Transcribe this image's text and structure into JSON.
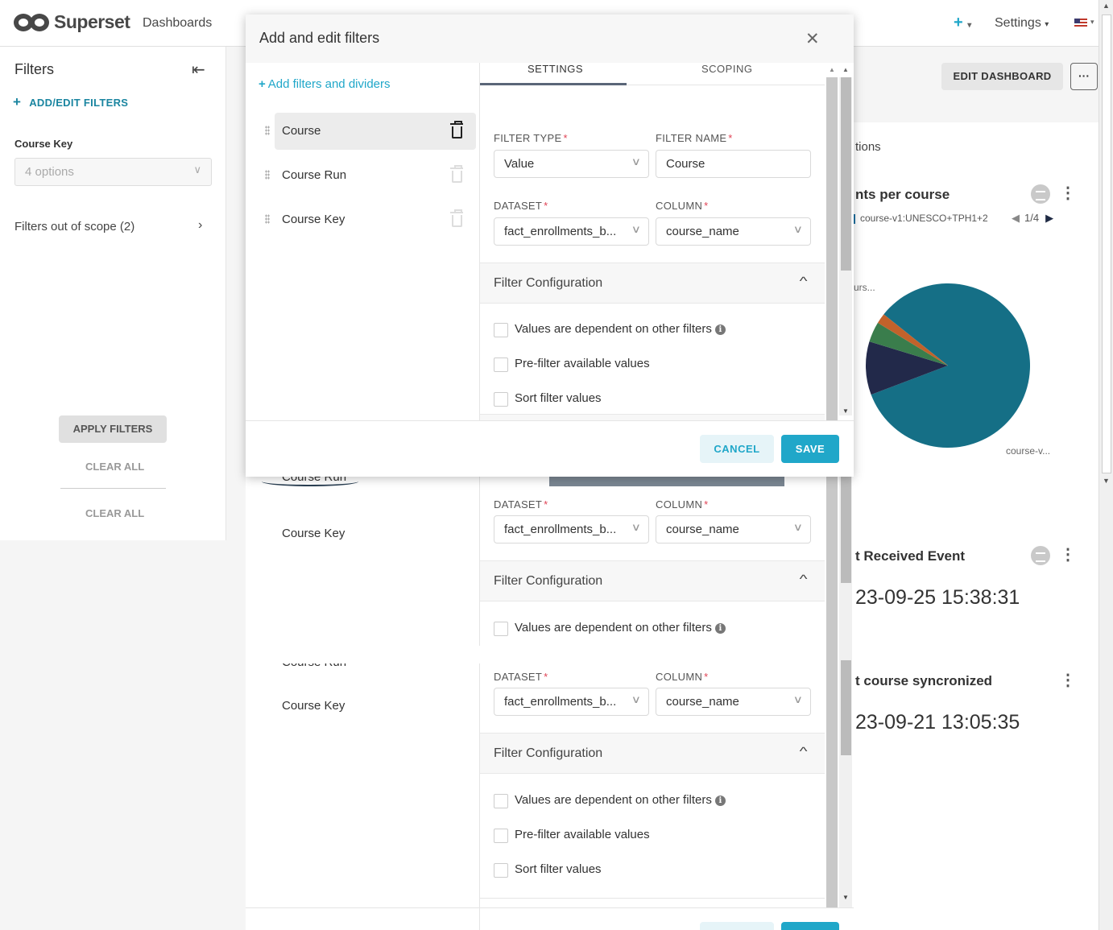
{
  "nav": {
    "brand": "Superset",
    "dashboards": "Dashboards",
    "plus": "+",
    "settings": "Settings"
  },
  "sidebar": {
    "title": "Filters",
    "add_edit": "ADD/EDIT FILTERS",
    "course_key_label": "Course Key",
    "course_key_placeholder": "4 options",
    "out_of_scope": "Filters out of scope (2)",
    "apply": "APPLY FILTERS",
    "clear_all_1": "CLEAR ALL",
    "clear_all_2": "CLEAR ALL"
  },
  "dashboard": {
    "edit_button": "EDIT DASHBOARD",
    "more": "···",
    "partial_header": "tions",
    "chart_title": "nts per course",
    "legend_item": "course-v1:UNESCO+TPH1+2",
    "pager": "1/4",
    "pie_label_top": "urs...",
    "pie_label_bottom": "course-v...",
    "event_title": "t Received Event",
    "event_value": "23-09-25 15:38:31",
    "sync_title": "t course syncronized",
    "sync_value": "23-09-21 13:05:35",
    "pie_colors": [
      "#156f86",
      "#22294a",
      "#3a7d4c",
      "#c2622b"
    ],
    "pie_values": [
      0.835,
      0.105,
      0.04,
      0.02
    ]
  },
  "modal": {
    "title": "Add and edit filters",
    "add_link": "Add filters and dividers",
    "filters": [
      {
        "name": "Course",
        "active": true
      },
      {
        "name": "Course Run",
        "active": false
      },
      {
        "name": "Course Key",
        "active": false
      }
    ],
    "tabs": {
      "settings": "SETTINGS",
      "scoping": "SCOPING"
    },
    "form": {
      "filter_type_label": "FILTER TYPE",
      "filter_type_value": "Value",
      "filter_name_label": "FILTER NAME",
      "filter_name_value": "Course",
      "dataset_label": "DATASET",
      "dataset_value": "fact_enrollments_b...",
      "column_label": "COLUMN",
      "column_value": "course_name",
      "required_mark": "*"
    },
    "config": {
      "title": "Filter Configuration",
      "opt_dependent": "Values are dependent on other filters",
      "opt_prefilter": "Pre-filter available values",
      "opt_sort": "Sort filter values"
    },
    "cancel": "CANCEL",
    "save": "SAVE"
  },
  "ghost": {
    "course_run_partial": "Course Run",
    "course_key": "Course Key"
  }
}
